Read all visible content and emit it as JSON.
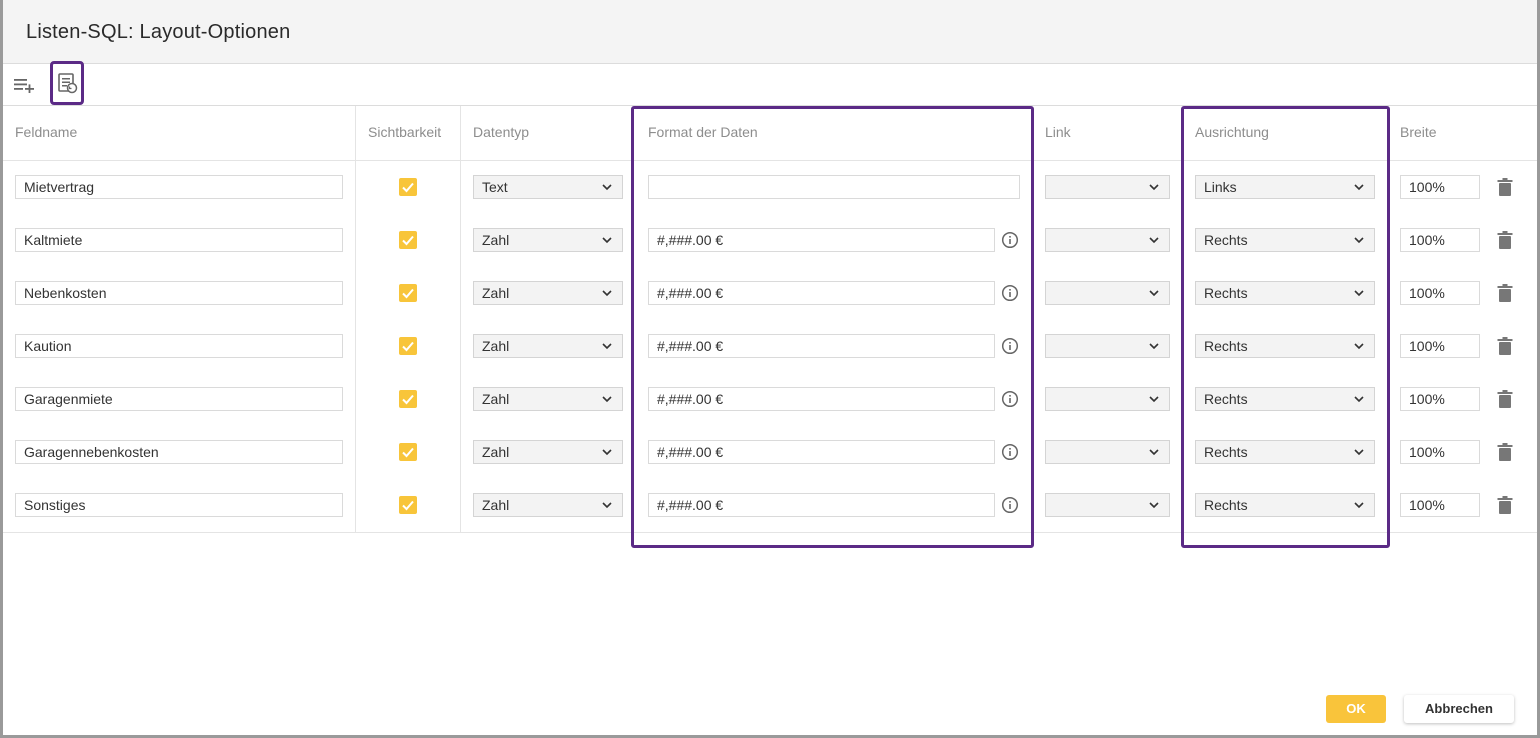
{
  "dialog": {
    "title": "Listen-SQL: Layout-Optionen"
  },
  "toolbar": {
    "add_icon": "playlist-add-icon",
    "reset_icon": "list-reset-icon"
  },
  "table": {
    "headers": {
      "fieldname": "Feldname",
      "visibility": "Sichtbarkeit",
      "datatype": "Datentyp",
      "format": "Format der Daten",
      "link": "Link",
      "alignment": "Ausrichtung",
      "width": "Breite"
    },
    "rows": [
      {
        "name": "Mietvertrag",
        "visible": true,
        "datatype": "Text",
        "format": "",
        "link": "",
        "alignment": "Links",
        "width": "100%",
        "show_info": false
      },
      {
        "name": "Kaltmiete",
        "visible": true,
        "datatype": "Zahl",
        "format": "#,###.00 €",
        "link": "",
        "alignment": "Rechts",
        "width": "100%",
        "show_info": true
      },
      {
        "name": "Nebenkosten",
        "visible": true,
        "datatype": "Zahl",
        "format": "#,###.00 €",
        "link": "",
        "alignment": "Rechts",
        "width": "100%",
        "show_info": true
      },
      {
        "name": "Kaution",
        "visible": true,
        "datatype": "Zahl",
        "format": "#,###.00 €",
        "link": "",
        "alignment": "Rechts",
        "width": "100%",
        "show_info": true
      },
      {
        "name": "Garagenmiete",
        "visible": true,
        "datatype": "Zahl",
        "format": "#,###.00 €",
        "link": "",
        "alignment": "Rechts",
        "width": "100%",
        "show_info": true
      },
      {
        "name": "Garagennebenkosten",
        "visible": true,
        "datatype": "Zahl",
        "format": "#,###.00 €",
        "link": "",
        "alignment": "Rechts",
        "width": "100%",
        "show_info": true
      },
      {
        "name": "Sonstiges",
        "visible": true,
        "datatype": "Zahl",
        "format": "#,###.00 €",
        "link": "",
        "alignment": "Rechts",
        "width": "100%",
        "show_info": true
      }
    ]
  },
  "footer": {
    "ok_label": "OK",
    "cancel_label": "Abbrechen"
  },
  "colors": {
    "accent": "#f8c53a",
    "highlight": "#5b2a86"
  }
}
